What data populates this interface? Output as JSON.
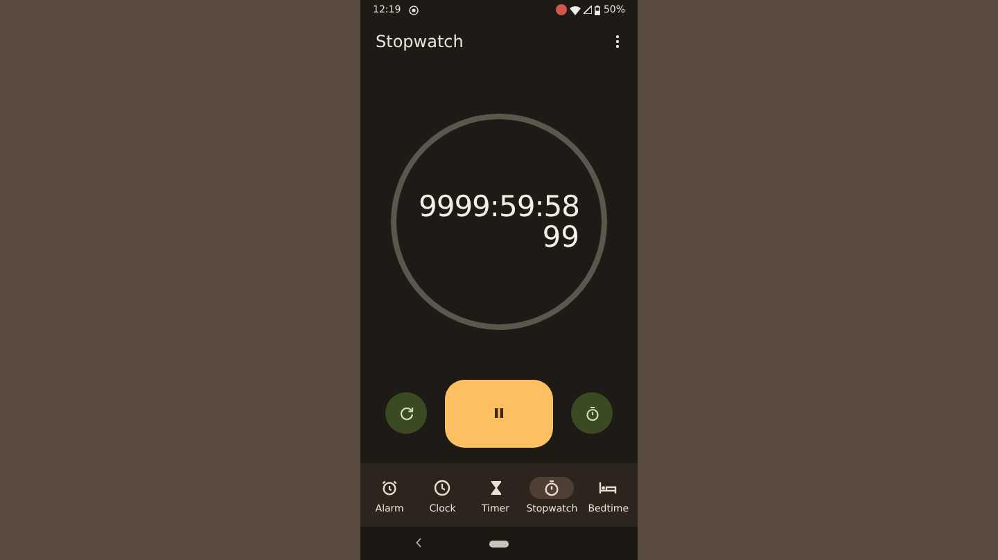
{
  "status_bar": {
    "time": "12:19",
    "battery": "50%"
  },
  "app_bar": {
    "title": "Stopwatch"
  },
  "stopwatch": {
    "time": "9999:59:58",
    "hundredths": "99",
    "running": true
  },
  "tabs": [
    {
      "label": "Alarm",
      "kind": "alarm",
      "selected": false
    },
    {
      "label": "Clock",
      "kind": "clock",
      "selected": false
    },
    {
      "label": "Timer",
      "kind": "timer",
      "selected": false
    },
    {
      "label": "Stopwatch",
      "kind": "stopwatch",
      "selected": true
    },
    {
      "label": "Bedtime",
      "kind": "bedtime",
      "selected": false
    }
  ]
}
